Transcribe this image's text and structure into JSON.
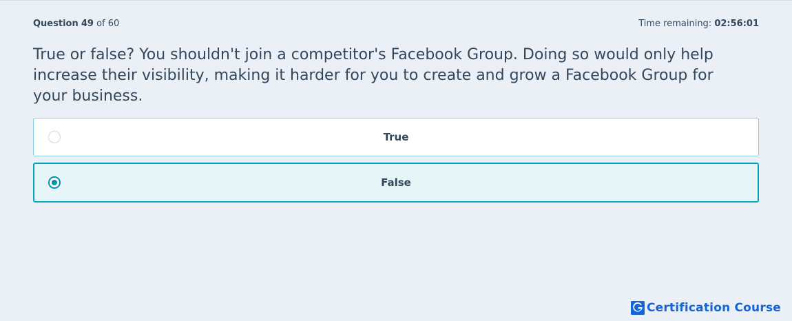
{
  "header": {
    "question_label": "Question",
    "question_number": "49",
    "question_of": "of 60",
    "time_label": "Time remaining:",
    "time_value": "02:56:01"
  },
  "question": {
    "text": "True or false? You shouldn't join a competitor's Facebook Group. Doing so would only help increase their visibility, making it harder for you to create and grow a Facebook Group for your business."
  },
  "options": [
    {
      "label": "True",
      "selected": false
    },
    {
      "label": "False",
      "selected": true
    }
  ],
  "brand": {
    "text": "Certification Course",
    "logo_letter": "G",
    "color": "#1565d8"
  },
  "colors": {
    "accent": "#00a4bd",
    "radio_selected": "#0091ae",
    "text": "#33475b",
    "background": "#eaf0f6"
  }
}
